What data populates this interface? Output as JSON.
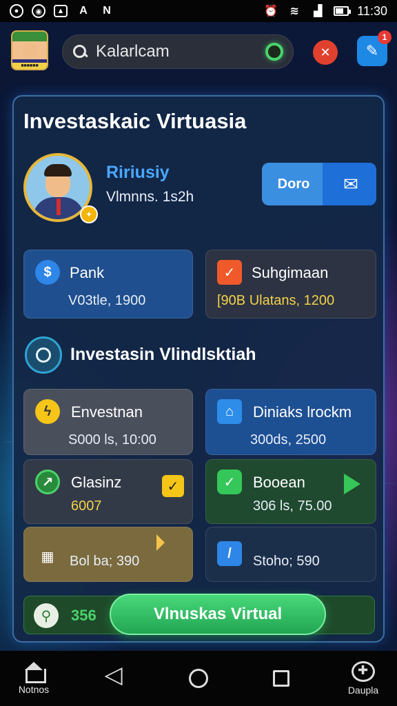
{
  "status_bar": {
    "left_icons": [
      "notification-icon",
      "app-icon",
      "gallery-icon",
      "font-icon",
      "muted-icon"
    ],
    "right_icons": [
      "alarm-icon",
      "wifi-icon",
      "signal-icon",
      "battery-icon"
    ],
    "battery_level": 0.6,
    "time": "11:30"
  },
  "header": {
    "search_text": "Kalarlcam",
    "notification_count": "1"
  },
  "panel": {
    "title": "Investaskaic Virtuasia",
    "profile": {
      "name": "Ririusiy",
      "subtitle": "Vlmnns. 1s2h"
    },
    "done_button": "Doro",
    "cards_top": [
      {
        "title": "Pank",
        "value": "V03tle, 1900",
        "icon": "dollar-icon",
        "color": "#1f4f8e"
      },
      {
        "title": "Suhgimaan",
        "value": "[90B Ulatans, 1200",
        "icon": "checkbox-icon",
        "color": "#2d3342"
      }
    ],
    "section_title": "Investasin Vlindlsktiah",
    "grid": [
      {
        "title": "Envestnan",
        "value": "S000 ls, 10:00",
        "icon": "bolt-icon"
      },
      {
        "title": "Diniaks lrockm",
        "value": "300ds, 2500",
        "icon": "building-icon"
      },
      {
        "title": "Glasinz",
        "value": "6007",
        "icon": "chart-icon"
      },
      {
        "title": "Booean",
        "value": "306 ls, 75.00",
        "icon": "check-icon"
      },
      {
        "title": "",
        "value": "Bol ba; 390",
        "icon": "box-icon"
      },
      {
        "title": "",
        "value": "Stoho; 590",
        "icon": "pencil-icon"
      }
    ],
    "bottom": {
      "count": "356",
      "cta": "Vlnuskas Virtual"
    }
  },
  "nav": {
    "left_label": "Notnos",
    "right_label": "Daupla"
  },
  "colors": {
    "accent_blue": "#1e88e5",
    "accent_green": "#22a552",
    "accent_gold": "#e6b73a",
    "danger": "#e53935"
  }
}
